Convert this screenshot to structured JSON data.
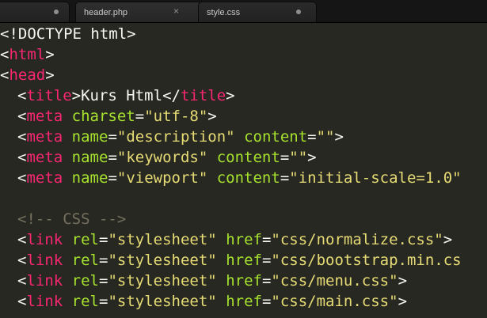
{
  "tabs": [
    {
      "label": "",
      "indicator": "dot"
    },
    {
      "label": "header.php",
      "indicator": "close"
    },
    {
      "label": "style.css",
      "indicator": "dot"
    }
  ],
  "code": {
    "doctype": "<!DOCTYPE html>",
    "html_open": "<",
    "html_tag": "html",
    "html_close": ">",
    "head_open": "<",
    "head_tag": "head",
    "head_close": ">",
    "title": {
      "open": "<",
      "tag": "title",
      "gt": ">",
      "text": "Kurs Html",
      "end_open": "</",
      "end_tag": "title",
      "end_gt": ">"
    },
    "meta_charset": {
      "open": "<",
      "tag": "meta",
      "attr": "charset",
      "eq": "=",
      "val": "\"utf-8\"",
      "gt": ">"
    },
    "meta_desc": {
      "open": "<",
      "tag": "meta",
      "attr1": "name",
      "eq1": "=",
      "val1": "\"description\"",
      "attr2": "content",
      "eq2": "=",
      "val2": "\"\"",
      "gt": ">"
    },
    "meta_keys": {
      "open": "<",
      "tag": "meta",
      "attr1": "name",
      "eq1": "=",
      "val1": "\"keywords\"",
      "attr2": "content",
      "eq2": "=",
      "val2": "\"\"",
      "gt": ">"
    },
    "meta_view": {
      "open": "<",
      "tag": "meta",
      "attr1": "name",
      "eq1": "=",
      "val1": "\"viewport\"",
      "attr2": "content",
      "eq2": "=",
      "val2": "\"initial-scale=1.0\""
    },
    "comment": "<!-- CSS -->",
    "links": [
      {
        "open": "<",
        "tag": "link",
        "attr1": "rel",
        "eq1": "=",
        "val1": "\"stylesheet\"",
        "attr2": "href",
        "eq2": "=",
        "val2": "\"css/normalize.css\"",
        "gt": ">"
      },
      {
        "open": "<",
        "tag": "link",
        "attr1": "rel",
        "eq1": "=",
        "val1": "\"stylesheet\"",
        "attr2": "href",
        "eq2": "=",
        "val2": "\"css/bootstrap.min.cs",
        "gt": ""
      },
      {
        "open": "<",
        "tag": "link",
        "attr1": "rel",
        "eq1": "=",
        "val1": "\"stylesheet\"",
        "attr2": "href",
        "eq2": "=",
        "val2": "\"css/menu.css\"",
        "gt": ">"
      },
      {
        "open": "<",
        "tag": "link",
        "attr1": "rel",
        "eq1": "=",
        "val1": "\"stylesheet\"",
        "attr2": "href",
        "eq2": "=",
        "val2": "\"css/main.css\"",
        "gt": ">"
      }
    ]
  },
  "colors": {
    "background": "#272822",
    "tag": "#f92672",
    "attribute": "#a6e22e",
    "string": "#e6db74",
    "comment": "#75715e",
    "text": "#f8f8f2"
  }
}
